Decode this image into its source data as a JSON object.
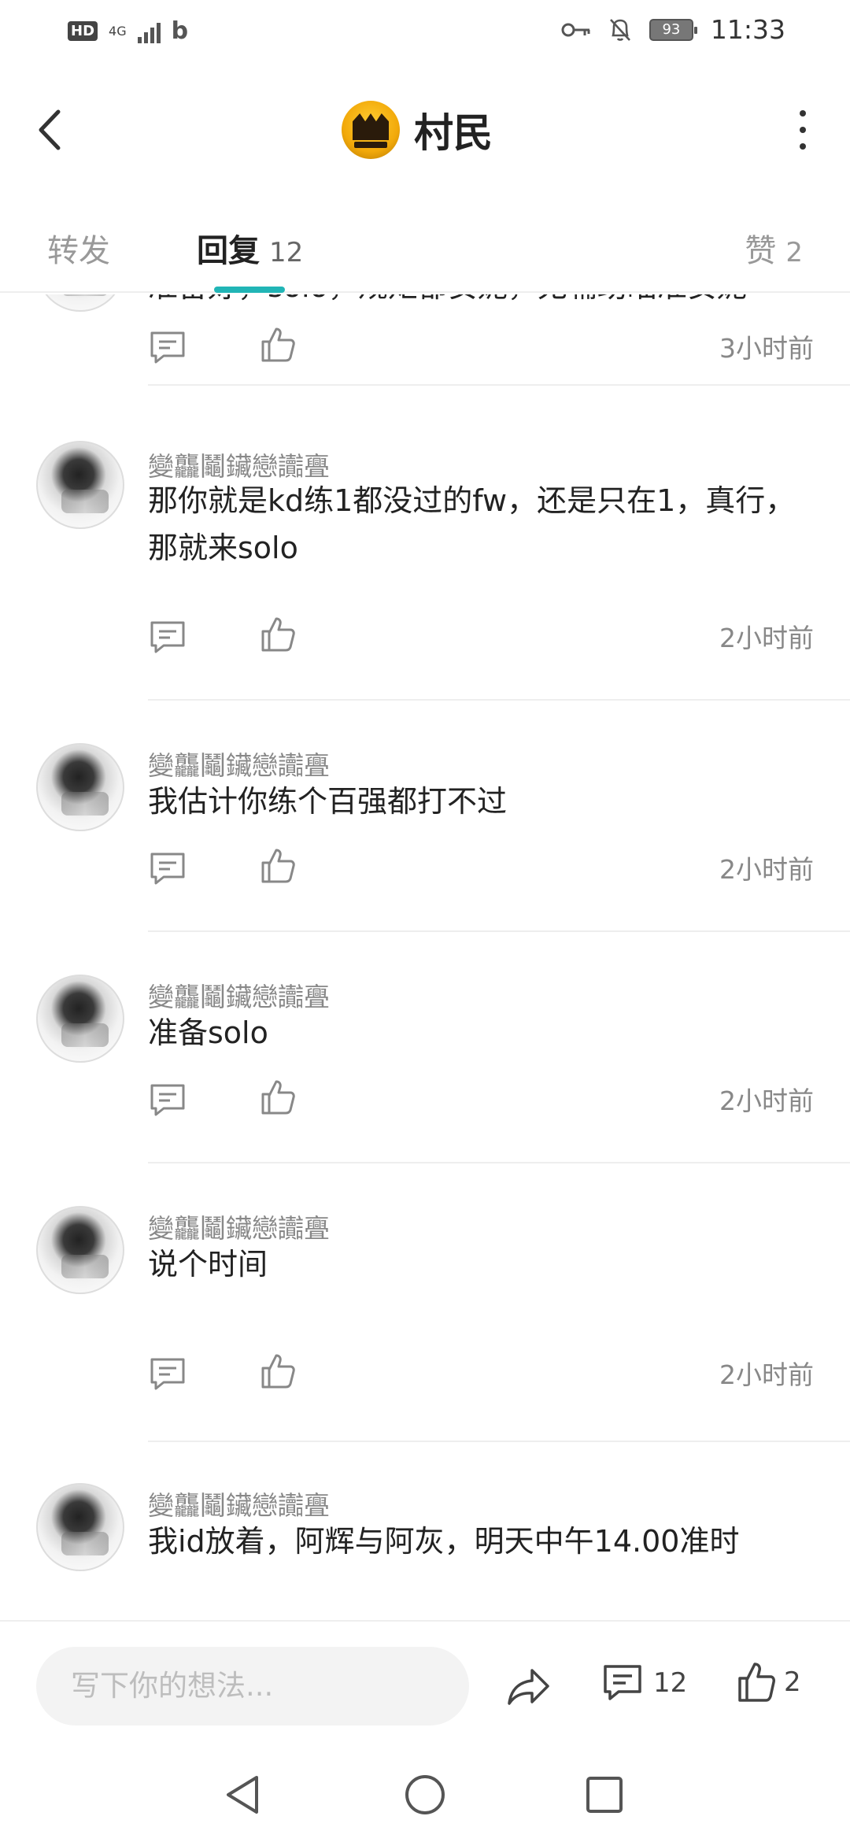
{
  "status_bar": {
    "hd": "HD",
    "network": "4G",
    "app_b": "b",
    "battery": "93",
    "time": "11:33"
  },
  "header": {
    "title": "村民"
  },
  "tabs": {
    "repost": "转发",
    "reply": "回复",
    "reply_count": "12",
    "like": "赞",
    "like_count": "2"
  },
  "comments": [
    {
      "username": "",
      "content": "准备好，solo，规矩都安妮，无辅助瞄准安妮",
      "time": "3小时前"
    },
    {
      "username": "變龘鬮鑶戀讟亹",
      "content": "那你就是kd练1都没过的fw，还是只在1，真行，那就来solo",
      "time": "2小时前"
    },
    {
      "username": "變龘鬮鑶戀讟亹",
      "content": "我估计你练个百强都打不过",
      "time": "2小时前"
    },
    {
      "username": "變龘鬮鑶戀讟亹",
      "content": "准备solo",
      "time": "2小时前"
    },
    {
      "username": "變龘鬮鑶戀讟亹",
      "content": "说个时间",
      "time": "2小时前"
    },
    {
      "username": "變龘鬮鑶戀讟亹",
      "content": "我id放着，阿辉与阿灰，明天中午14.00准时",
      "time": ""
    }
  ],
  "bottom_bar": {
    "input_placeholder": "写下你的想法...",
    "comment_count": "12",
    "like_count": "2"
  },
  "colors": {
    "accent": "#21b5b6",
    "muted": "#888888"
  },
  "icons": {
    "back": "chevron-left-icon",
    "more": "more-vertical-icon",
    "reply": "comment-icon",
    "like": "thumbs-up-icon",
    "share": "share-icon"
  }
}
